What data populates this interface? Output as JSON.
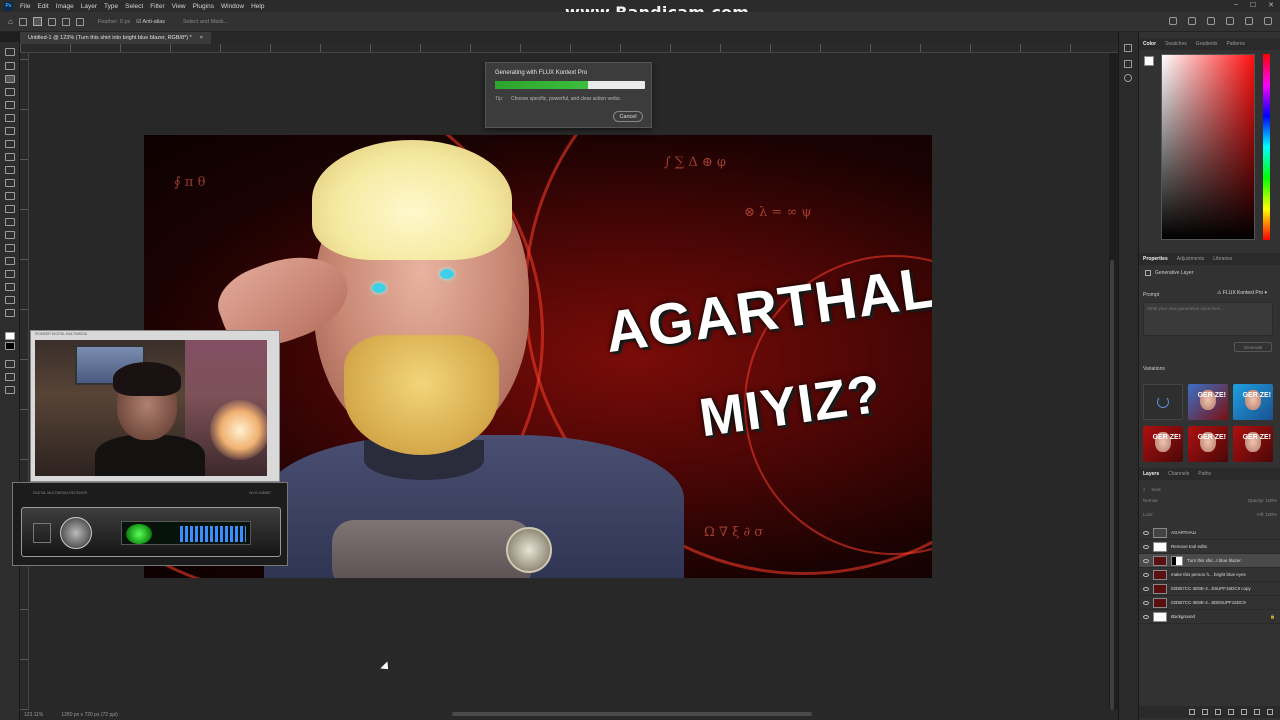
{
  "watermark": "www.Bandicam.com",
  "menu": {
    "app_icon": "Ps",
    "items": [
      "File",
      "Edit",
      "Image",
      "Layer",
      "Type",
      "Select",
      "Filter",
      "View",
      "Plugins",
      "Window",
      "Help"
    ]
  },
  "options": {
    "feather_label": "Feather: 0 px",
    "antialias_label": "Anti-alias",
    "select_mask_label": "Select and Mask..."
  },
  "document": {
    "tab_title": "Untitled-1 @ 123% (Turn this shirt into bright blue blazer, RGB/8*) *"
  },
  "thumbnail": {
    "title_line1": "AGARTHALI",
    "title_line2": "MIYIZ?"
  },
  "generation_dialog": {
    "title": "Generating with FLUX Kontext Pro",
    "progress_fraction": 0.62,
    "tip_label": "Tip:",
    "tip_text": "Choose specific, powerful, and clear action verbs.",
    "cancel_label": "Cancel"
  },
  "webcam": {
    "header_text": "PIONEER DIGITAL MULTIMEDIA",
    "radio_caption_left": "DIGITAL MULTIMEDIA RECEIVER",
    "radio_caption_right": "MVH-X380BT"
  },
  "panels": {
    "color_tabs": [
      "Color",
      "Swatches",
      "Gradients",
      "Patterns"
    ],
    "properties_tabs": [
      "Properties",
      "Adjustments",
      "Libraries"
    ],
    "layer_type": "Generative Layer",
    "prompt_label": "Prompt",
    "model_name": "FLUX Kontext Pro",
    "prompt_placeholder": "Write your new generative input here...",
    "generate_label": "Generate",
    "variations_label": "Variations",
    "variation_text": "GER ZE!",
    "layers_tabs": [
      "Layers",
      "Channels",
      "Paths"
    ],
    "layer_search": "Kind",
    "blend_mode": "Normal",
    "opacity_label": "Opacity:",
    "opacity_value": "100%",
    "lock_label": "Lock:",
    "fill_label": "Fill:",
    "fill_value": "100%",
    "layers": [
      {
        "name": "AGARTHALI",
        "thumb": "text",
        "selected": false
      },
      {
        "name": "Remove tool edits",
        "thumb": "white",
        "selected": false
      },
      {
        "name": "Turn this shir...t blue blazer",
        "thumb": "image",
        "selected": true
      },
      {
        "name": "make this person h... bright blue eyes",
        "thumb": "image",
        "selected": false
      },
      {
        "name": "02DB7CC-3E8E-4...E5UPF16DC9 copy",
        "thumb": "image",
        "selected": false
      },
      {
        "name": "02DB7CC-3E8E-4...6DE5UPF16DC9",
        "thumb": "image",
        "selected": false
      },
      {
        "name": "Background",
        "thumb": "white",
        "selected": false
      }
    ]
  },
  "status": {
    "zoom": "123.11%",
    "doc_size": "1280 px x 720 px (72 ppi)"
  }
}
